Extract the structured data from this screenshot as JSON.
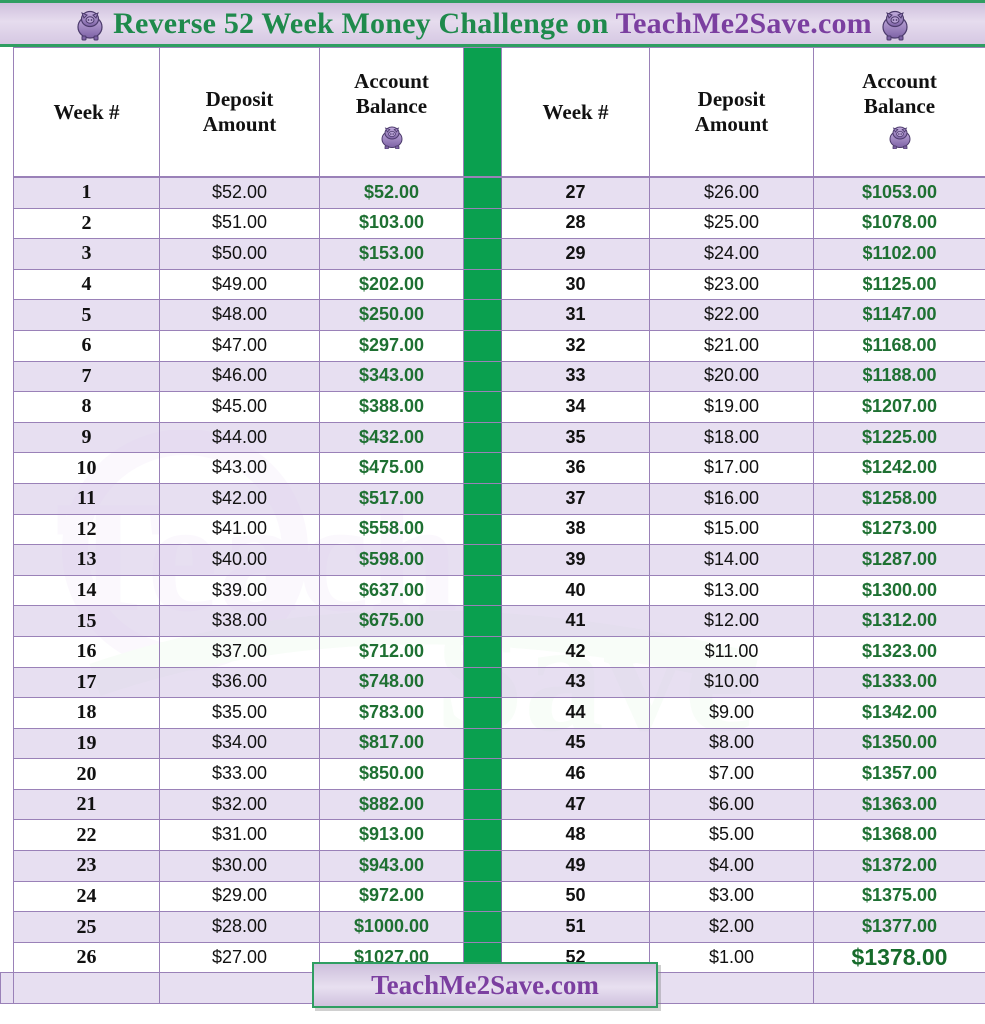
{
  "header": {
    "title_part_green": "Reverse 52 Week Money Challenge on ",
    "title_part_purple": "TeachMe2Save.com",
    "left_piggy_icon": "piggy-bank-icon",
    "right_piggy_icon": "piggy-bank-icon"
  },
  "columns": {
    "week": "Week #",
    "deposit_line1": "Deposit",
    "deposit_line2": "Amount",
    "balance_line1": "Account",
    "balance_line2": "Balance",
    "balance_icon": "piggy-bank-icon"
  },
  "colors": {
    "accent_green": "#0aa04f",
    "title_green": "#1f8a4c",
    "title_purple": "#7b3fa0",
    "balance_green": "#1e7032",
    "row_purple": "#e2d8ee",
    "grid_line": "#9a81b8"
  },
  "footer": {
    "label": "TeachMe2Save.com"
  },
  "watermark": {
    "text": "TeachMe2Save.com"
  },
  "chart_data": {
    "type": "table",
    "title": "Reverse 52 Week Money Challenge on TeachMe2Save.com",
    "columns": [
      "Week #",
      "Deposit Amount",
      "Account Balance"
    ],
    "left": [
      {
        "week": "1",
        "deposit": "$52.00",
        "balance": "$52.00"
      },
      {
        "week": "2",
        "deposit": "$51.00",
        "balance": "$103.00"
      },
      {
        "week": "3",
        "deposit": "$50.00",
        "balance": "$153.00"
      },
      {
        "week": "4",
        "deposit": "$49.00",
        "balance": "$202.00"
      },
      {
        "week": "5",
        "deposit": "$48.00",
        "balance": "$250.00"
      },
      {
        "week": "6",
        "deposit": "$47.00",
        "balance": "$297.00"
      },
      {
        "week": "7",
        "deposit": "$46.00",
        "balance": "$343.00"
      },
      {
        "week": "8",
        "deposit": "$45.00",
        "balance": "$388.00"
      },
      {
        "week": "9",
        "deposit": "$44.00",
        "balance": "$432.00"
      },
      {
        "week": "10",
        "deposit": "$43.00",
        "balance": "$475.00"
      },
      {
        "week": "11",
        "deposit": "$42.00",
        "balance": "$517.00"
      },
      {
        "week": "12",
        "deposit": "$41.00",
        "balance": "$558.00"
      },
      {
        "week": "13",
        "deposit": "$40.00",
        "balance": "$598.00"
      },
      {
        "week": "14",
        "deposit": "$39.00",
        "balance": "$637.00"
      },
      {
        "week": "15",
        "deposit": "$38.00",
        "balance": "$675.00"
      },
      {
        "week": "16",
        "deposit": "$37.00",
        "balance": "$712.00"
      },
      {
        "week": "17",
        "deposit": "$36.00",
        "balance": "$748.00"
      },
      {
        "week": "18",
        "deposit": "$35.00",
        "balance": "$783.00"
      },
      {
        "week": "19",
        "deposit": "$34.00",
        "balance": "$817.00"
      },
      {
        "week": "20",
        "deposit": "$33.00",
        "balance": "$850.00"
      },
      {
        "week": "21",
        "deposit": "$32.00",
        "balance": "$882.00"
      },
      {
        "week": "22",
        "deposit": "$31.00",
        "balance": "$913.00"
      },
      {
        "week": "23",
        "deposit": "$30.00",
        "balance": "$943.00"
      },
      {
        "week": "24",
        "deposit": "$29.00",
        "balance": "$972.00"
      },
      {
        "week": "25",
        "deposit": "$28.00",
        "balance": "$1000.00"
      },
      {
        "week": "26",
        "deposit": "$27.00",
        "balance": "$1027.00"
      }
    ],
    "right": [
      {
        "week": "27",
        "deposit": "$26.00",
        "balance": "$1053.00"
      },
      {
        "week": "28",
        "deposit": "$25.00",
        "balance": "$1078.00"
      },
      {
        "week": "29",
        "deposit": "$24.00",
        "balance": "$1102.00"
      },
      {
        "week": "30",
        "deposit": "$23.00",
        "balance": "$1125.00"
      },
      {
        "week": "31",
        "deposit": "$22.00",
        "balance": "$1147.00"
      },
      {
        "week": "32",
        "deposit": "$21.00",
        "balance": "$1168.00"
      },
      {
        "week": "33",
        "deposit": "$20.00",
        "balance": "$1188.00"
      },
      {
        "week": "34",
        "deposit": "$19.00",
        "balance": "$1207.00"
      },
      {
        "week": "35",
        "deposit": "$18.00",
        "balance": "$1225.00"
      },
      {
        "week": "36",
        "deposit": "$17.00",
        "balance": "$1242.00"
      },
      {
        "week": "37",
        "deposit": "$16.00",
        "balance": "$1258.00"
      },
      {
        "week": "38",
        "deposit": "$15.00",
        "balance": "$1273.00"
      },
      {
        "week": "39",
        "deposit": "$14.00",
        "balance": "$1287.00"
      },
      {
        "week": "40",
        "deposit": "$13.00",
        "balance": "$1300.00"
      },
      {
        "week": "41",
        "deposit": "$12.00",
        "balance": "$1312.00"
      },
      {
        "week": "42",
        "deposit": "$11.00",
        "balance": "$1323.00"
      },
      {
        "week": "43",
        "deposit": "$10.00",
        "balance": "$1333.00"
      },
      {
        "week": "44",
        "deposit": "$9.00",
        "balance": "$1342.00"
      },
      {
        "week": "45",
        "deposit": "$8.00",
        "balance": "$1350.00"
      },
      {
        "week": "46",
        "deposit": "$7.00",
        "balance": "$1357.00"
      },
      {
        "week": "47",
        "deposit": "$6.00",
        "balance": "$1363.00"
      },
      {
        "week": "48",
        "deposit": "$5.00",
        "balance": "$1368.00"
      },
      {
        "week": "49",
        "deposit": "$4.00",
        "balance": "$1372.00"
      },
      {
        "week": "50",
        "deposit": "$3.00",
        "balance": "$1375.00"
      },
      {
        "week": "51",
        "deposit": "$2.00",
        "balance": "$1377.00"
      },
      {
        "week": "52",
        "deposit": "$1.00",
        "balance": "$1378.00"
      }
    ]
  }
}
